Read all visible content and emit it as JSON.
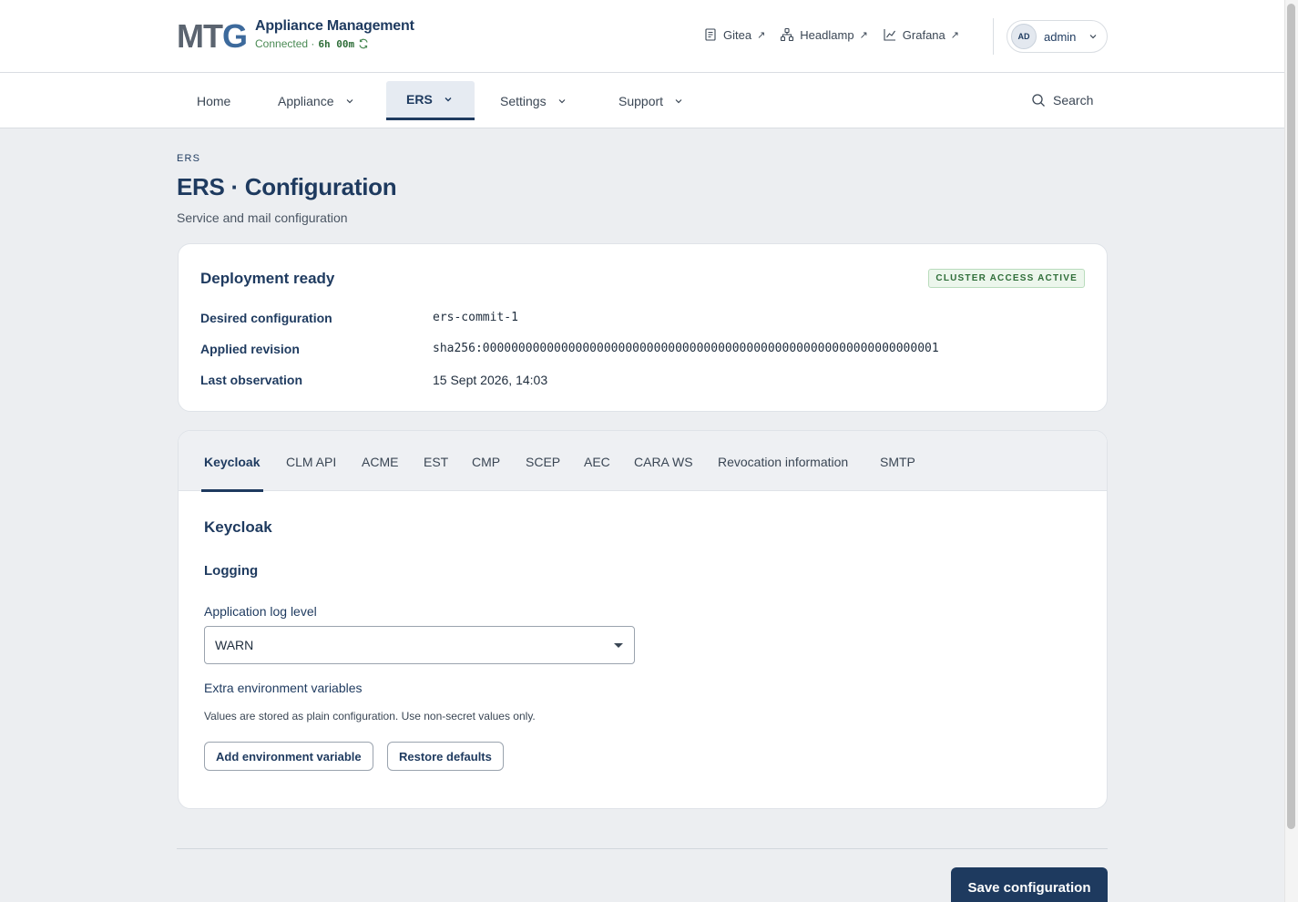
{
  "header": {
    "logo_prefix": "MT",
    "logo_suffix": "G",
    "app_title": "Appliance Management",
    "status_text": "Connected ·",
    "uptime": "6h 00m",
    "links": [
      {
        "label": "Gitea",
        "icon": "document-icon"
      },
      {
        "label": "Headlamp",
        "icon": "nodes-icon"
      },
      {
        "label": "Grafana",
        "icon": "chart-line-icon"
      }
    ],
    "external_glyph": "↗",
    "user": {
      "initials": "AD",
      "name": "admin"
    }
  },
  "nav": {
    "items": [
      {
        "label": "Home"
      },
      {
        "label": "Appliance"
      },
      {
        "label": "ERS"
      },
      {
        "label": "Settings"
      },
      {
        "label": "Support"
      }
    ],
    "search_label": "Search"
  },
  "page": {
    "breadcrumb": "ERS",
    "title": "ERS · Configuration",
    "subtitle": "Service and mail configuration"
  },
  "deployment": {
    "title": "Deployment ready",
    "badge": "CLUSTER ACCESS ACTIVE",
    "rows": [
      {
        "key": "Desired configuration",
        "value": "ers-commit-1"
      },
      {
        "key": "Applied revision",
        "value": "sha256:0000000000000000000000000000000000000000000000000000000000000001"
      },
      {
        "key": "Last observation",
        "value": "15 Sept 2026, 14:03"
      }
    ]
  },
  "tabs": [
    "Keycloak",
    "CLM API",
    "ACME",
    "EST",
    "CMP",
    "SCEP",
    "AEC",
    "CARA WS",
    "Revocation information",
    "SMTP"
  ],
  "active_tab": "Keycloak",
  "form": {
    "section_title": "Keycloak",
    "subsection_title": "Logging",
    "log_level_label": "Application log level",
    "log_level_value": "WARN",
    "env_label": "Extra environment variables",
    "env_hint": "Values are stored as plain configuration. Use non-secret values only.",
    "add_env_button": "Add environment variable",
    "restore_button": "Restore defaults"
  },
  "footer": {
    "save_button": "Save configuration"
  },
  "colors": {
    "primary": "#1e3a5f",
    "success": "#2f6e39",
    "background": "#eceef1"
  }
}
